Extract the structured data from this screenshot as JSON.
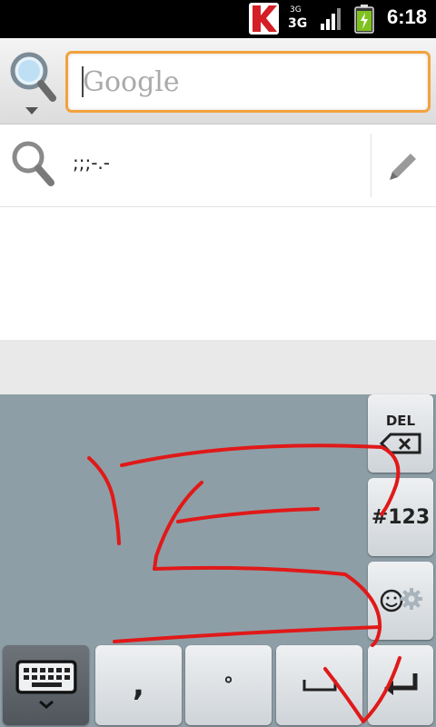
{
  "status_bar": {
    "network_small": "3G",
    "network_big": "3G",
    "time": "6:18",
    "icons": [
      "app-k-icon",
      "network-3g-icon",
      "signal-icon",
      "battery-icon"
    ]
  },
  "search": {
    "placeholder": "Google",
    "value": "",
    "accent_color": "#f2a23d"
  },
  "suggestion": {
    "text": ";;;-.-"
  },
  "keyboard": {
    "del_label": "DEL",
    "sym_label": "#123",
    "comma_label": ",",
    "degree_label": "°",
    "space_label": "␣",
    "stroke_color": "#e01919"
  }
}
